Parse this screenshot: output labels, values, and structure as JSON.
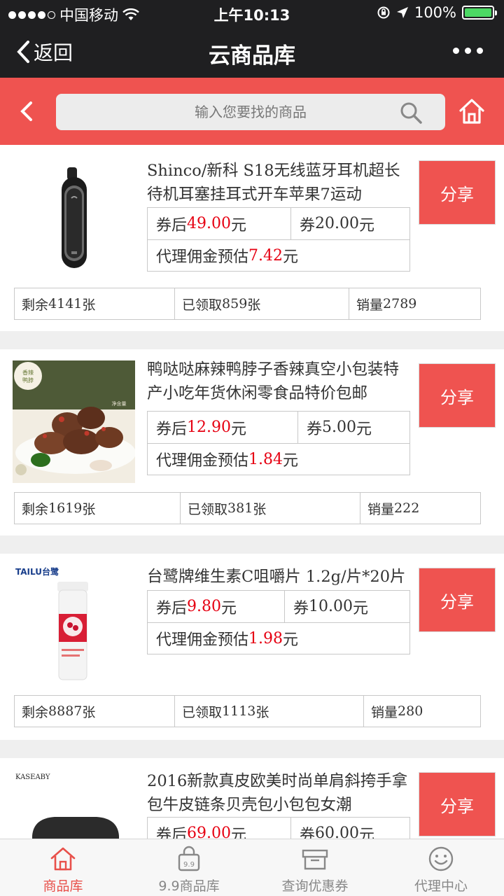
{
  "status_bar": {
    "carrier": "中国移动",
    "time": "上午10:13",
    "battery": "100%"
  },
  "nav": {
    "back_label": "返回",
    "title": "云商品库"
  },
  "search": {
    "placeholder": "输入您要找的商品"
  },
  "labels": {
    "share": "分享",
    "after_coupon_prefix": "券后",
    "coupon_prefix": "券",
    "currency_suffix": "元",
    "commission_prefix": "代理佣金预估",
    "remaining_prefix": "剩余",
    "remaining_suffix": "张",
    "claimed_prefix": "已领取",
    "claimed_suffix": "张",
    "sales_prefix": "销量"
  },
  "products": [
    {
      "title": "Shinco/新科 S18无线蓝牙耳机超长待机耳塞挂耳式开车苹果7运动",
      "price_after": "49.00",
      "coupon": "20.00",
      "commission": "7.42",
      "remaining": "4141",
      "claimed": "859",
      "sales": "2789",
      "image": "bluetooth-earphone"
    },
    {
      "title": "鸭哒哒麻辣鸭脖子香辣真空小包装特产小吃年货休闲零食品特价包邮",
      "price_after": "12.90",
      "coupon": "5.00",
      "commission": "1.84",
      "remaining": "1619",
      "claimed": "381",
      "sales": "222",
      "image": "spicy-duck-neck",
      "image_badges": [
        "香辣",
        "鸭脖"
      ],
      "image_caption": "净含量"
    },
    {
      "title": "台鹭牌维生素C咀嚼片 1.2g/片*20片",
      "price_after": "9.80",
      "coupon": "10.00",
      "commission": "1.98",
      "remaining": "8887",
      "claimed": "1113",
      "sales": "280",
      "image": "vitamin-c-tube",
      "image_brand": "TAILU台鹭"
    },
    {
      "title": "2016新款真皮欧美时尚单肩斜挎手拿包牛皮链条贝壳包小包包女潮",
      "price_after": "69.00",
      "coupon": "60.00",
      "commission": "",
      "remaining": "",
      "claimed": "",
      "sales": "",
      "image": "leather-handbag",
      "image_brand": "KASEABY"
    }
  ],
  "tabs": [
    {
      "label": "商品库",
      "icon": "home-icon",
      "active": true
    },
    {
      "label": "9.9商品库",
      "icon": "bag-icon",
      "active": false
    },
    {
      "label": "查询优惠券",
      "icon": "coupon-box-icon",
      "active": false
    },
    {
      "label": "代理中心",
      "icon": "smiley-icon",
      "active": false
    }
  ],
  "colors": {
    "accent": "#ef5350",
    "price_red": "#e60012",
    "dark_bar": "#1f1f21"
  }
}
